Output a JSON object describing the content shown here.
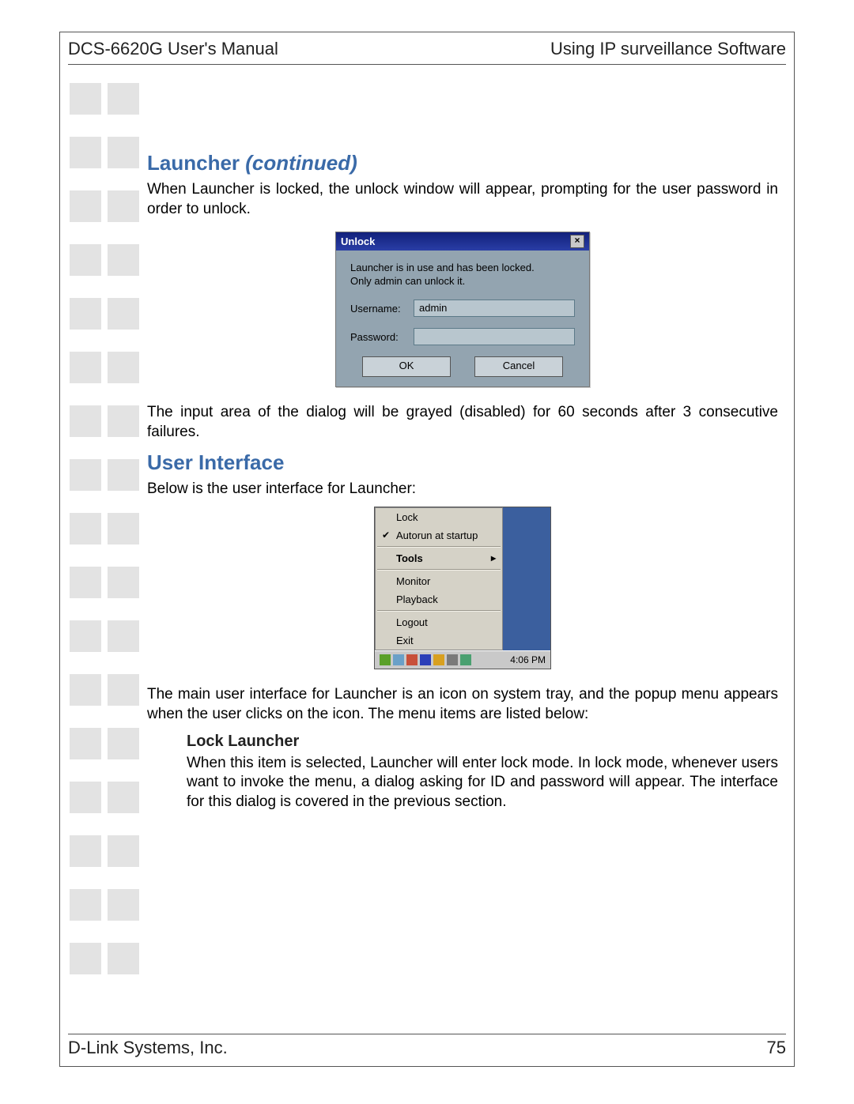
{
  "header": {
    "left": "DCS-6620G User's Manual",
    "right": "Using IP surveillance Software"
  },
  "footer": {
    "left": "D-Link Systems, Inc.",
    "right": "75"
  },
  "section1": {
    "title": "Launcher ",
    "title_ital": "(continued)",
    "para1": "When Launcher is locked, the unlock window will appear, prompting for the user password in order to unlock.",
    "para2": "The input area of the dialog will be grayed (disabled) for 60 seconds after 3 consecutive failures."
  },
  "unlock": {
    "title": "Unlock",
    "close": "×",
    "msg1": "Launcher is in use and has been locked.",
    "msg2": "Only admin can unlock it.",
    "username_label": "Username:",
    "username_value": "admin",
    "password_label": "Password:",
    "ok": "OK",
    "cancel": "Cancel"
  },
  "section2": {
    "title": "User Interface",
    "intro": "Below is the user interface for Launcher:",
    "desc": "The main user interface for Launcher is an icon on system tray, and the popup menu appears when the user clicks on the icon. The menu items are listed below:"
  },
  "menu": {
    "lock": "Lock",
    "autorun": "Autorun at startup",
    "tools": "Tools",
    "monitor": "Monitor",
    "playback": "Playback",
    "logout": "Logout",
    "exit": "Exit",
    "time": "4:06 PM"
  },
  "section3": {
    "title": "Lock Launcher",
    "body": "When this item is selected, Launcher will enter lock mode. In lock mode, whenever users want to invoke the menu, a dialog asking for ID and password will appear. The interface for this dialog is covered in the previous section."
  }
}
